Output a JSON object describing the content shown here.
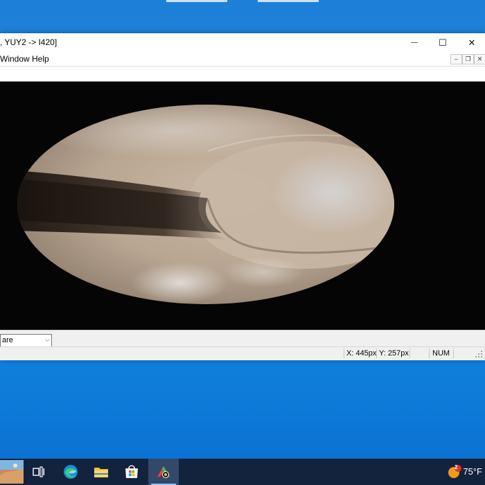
{
  "window": {
    "title": ", YUY2 -> I420]",
    "minimize_glyph": "—",
    "maximize_glyph": "☐",
    "close_glyph": "✕"
  },
  "menu": {
    "items": [
      "Window",
      "Help"
    ],
    "mdi_minimize_glyph": "–",
    "mdi_restore_glyph": "❐",
    "mdi_close_glyph": "✕"
  },
  "bottom": {
    "combo_value": "are",
    "combo_arrow": "⌵"
  },
  "status": {
    "x": "X: 445px",
    "y": "Y: 257px",
    "num": "NUM"
  },
  "taskbar": {
    "items": [
      "taskview-icon",
      "edge-icon",
      "file-explorer-icon",
      "store-icon",
      "camera-app-icon"
    ],
    "weather": {
      "temperature": "75°F",
      "badge": "2"
    }
  },
  "colors": {
    "desktop": "#1486e0",
    "taskbar": "#13233e",
    "video_bg": "#050505"
  }
}
